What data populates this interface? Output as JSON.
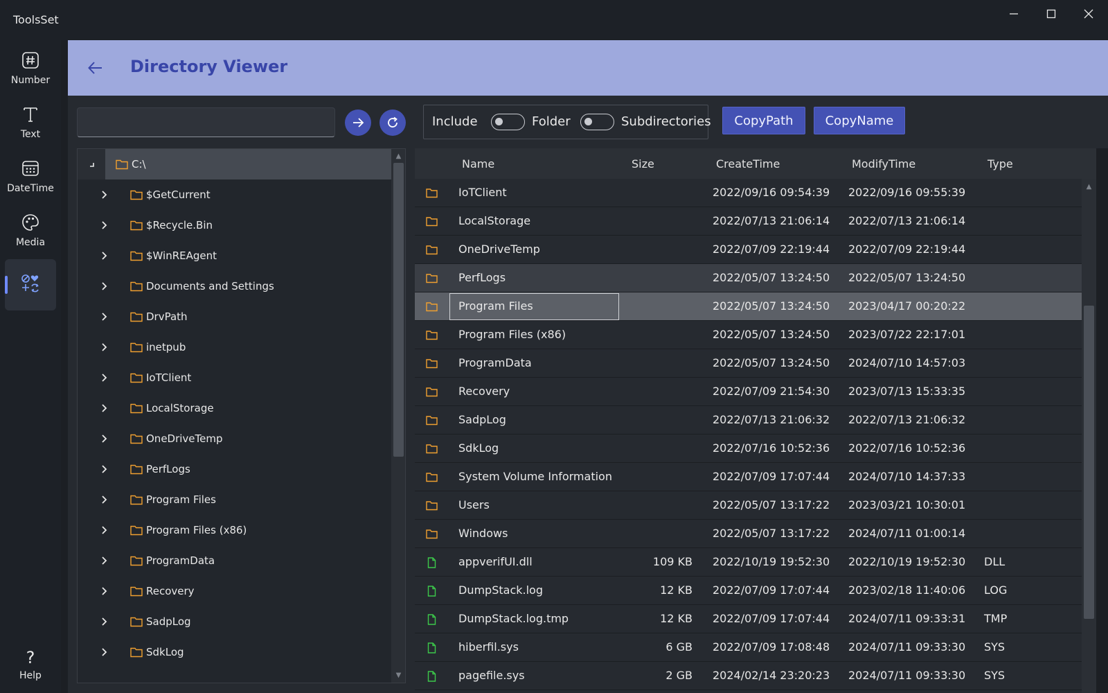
{
  "app": {
    "title": "ToolsSet"
  },
  "nav": {
    "items": [
      {
        "label": "Number",
        "icon": "hash-icon"
      },
      {
        "label": "Text",
        "icon": "text-icon"
      },
      {
        "label": "DateTime",
        "icon": "calendar-icon"
      },
      {
        "label": "Media",
        "icon": "palette-icon"
      },
      {
        "label": "",
        "icon": "symbols-icon"
      }
    ],
    "help_label": "Help"
  },
  "header": {
    "title": "Directory Viewer"
  },
  "path": {
    "value": "",
    "placeholder": ""
  },
  "options": {
    "include_label": "Include",
    "folder_label": "Folder",
    "subdirectories_label": "Subdirectories",
    "folder_on": false,
    "subdirectories_on": false
  },
  "buttons": {
    "copy_path": "CopyPath",
    "copy_name": "CopyName"
  },
  "tree": {
    "root": "C:\\",
    "items": [
      "$GetCurrent",
      "$Recycle.Bin",
      "$WinREAgent",
      "Documents and Settings",
      "DrvPath",
      "inetpub",
      "IoTClient",
      "LocalStorage",
      "OneDriveTemp",
      "PerfLogs",
      "Program Files",
      "Program Files (x86)",
      "ProgramData",
      "Recovery",
      "SadpLog",
      "SdkLog"
    ]
  },
  "grid": {
    "columns": {
      "name": "Name",
      "size": "Size",
      "create": "CreateTime",
      "modify": "ModifyTime",
      "type": "Type"
    },
    "rows": [
      {
        "kind": "folder",
        "name": "IoTClient",
        "size": "",
        "create": "2022/09/16 09:54:39",
        "modify": "2022/09/16 09:55:39",
        "type": ""
      },
      {
        "kind": "folder",
        "name": "LocalStorage",
        "size": "",
        "create": "2022/07/13 21:06:14",
        "modify": "2022/07/13 21:06:14",
        "type": ""
      },
      {
        "kind": "folder",
        "name": "OneDriveTemp",
        "size": "",
        "create": "2022/07/09 22:19:44",
        "modify": "2022/07/09 22:19:44",
        "type": ""
      },
      {
        "kind": "folder",
        "name": "PerfLogs",
        "size": "",
        "create": "2022/05/07 13:24:50",
        "modify": "2022/05/07 13:24:50",
        "type": ""
      },
      {
        "kind": "folder",
        "name": "Program Files",
        "size": "",
        "create": "2022/05/07 13:24:50",
        "modify": "2023/04/17 00:20:22",
        "type": ""
      },
      {
        "kind": "folder",
        "name": "Program Files (x86)",
        "size": "",
        "create": "2022/05/07 13:24:50",
        "modify": "2023/07/22 22:17:01",
        "type": ""
      },
      {
        "kind": "folder",
        "name": "ProgramData",
        "size": "",
        "create": "2022/05/07 13:24:50",
        "modify": "2024/07/10 14:57:03",
        "type": ""
      },
      {
        "kind": "folder",
        "name": "Recovery",
        "size": "",
        "create": "2022/07/09 21:54:30",
        "modify": "2023/07/13 15:33:35",
        "type": ""
      },
      {
        "kind": "folder",
        "name": "SadpLog",
        "size": "",
        "create": "2022/07/13 21:06:32",
        "modify": "2022/07/13 21:06:32",
        "type": ""
      },
      {
        "kind": "folder",
        "name": "SdkLog",
        "size": "",
        "create": "2022/07/16 10:52:36",
        "modify": "2022/07/16 10:52:36",
        "type": ""
      },
      {
        "kind": "folder",
        "name": "System Volume Information",
        "size": "",
        "create": "2022/07/09 17:07:44",
        "modify": "2024/07/10 14:37:33",
        "type": ""
      },
      {
        "kind": "folder",
        "name": "Users",
        "size": "",
        "create": "2022/05/07 13:17:22",
        "modify": "2023/03/21 10:30:01",
        "type": ""
      },
      {
        "kind": "folder",
        "name": "Windows",
        "size": "",
        "create": "2022/05/07 13:17:22",
        "modify": "2024/07/11 01:00:14",
        "type": ""
      },
      {
        "kind": "file",
        "name": "appverifUI.dll",
        "size": "109 KB",
        "create": "2022/10/19 19:52:30",
        "modify": "2022/10/19 19:52:30",
        "type": "DLL"
      },
      {
        "kind": "file",
        "name": "DumpStack.log",
        "size": "12 KB",
        "create": "2022/07/09 17:07:44",
        "modify": "2023/02/18 11:40:06",
        "type": "LOG"
      },
      {
        "kind": "file",
        "name": "DumpStack.log.tmp",
        "size": "12 KB",
        "create": "2022/07/09 17:07:44",
        "modify": "2024/07/11 09:33:31",
        "type": "TMP"
      },
      {
        "kind": "file",
        "name": "hiberfil.sys",
        "size": "6 GB",
        "create": "2022/07/09 17:08:48",
        "modify": "2024/07/11 09:33:30",
        "type": "SYS"
      },
      {
        "kind": "file",
        "name": "pagefile.sys",
        "size": "2 GB",
        "create": "2024/02/14 23:20:23",
        "modify": "2024/07/11 09:33:30",
        "type": "SYS"
      }
    ]
  },
  "colors": {
    "accent": "#4452b4",
    "header_bg": "#9ea9dd",
    "title": "#3845a8",
    "folder": "#f0a030",
    "file": "#3cc84a"
  }
}
